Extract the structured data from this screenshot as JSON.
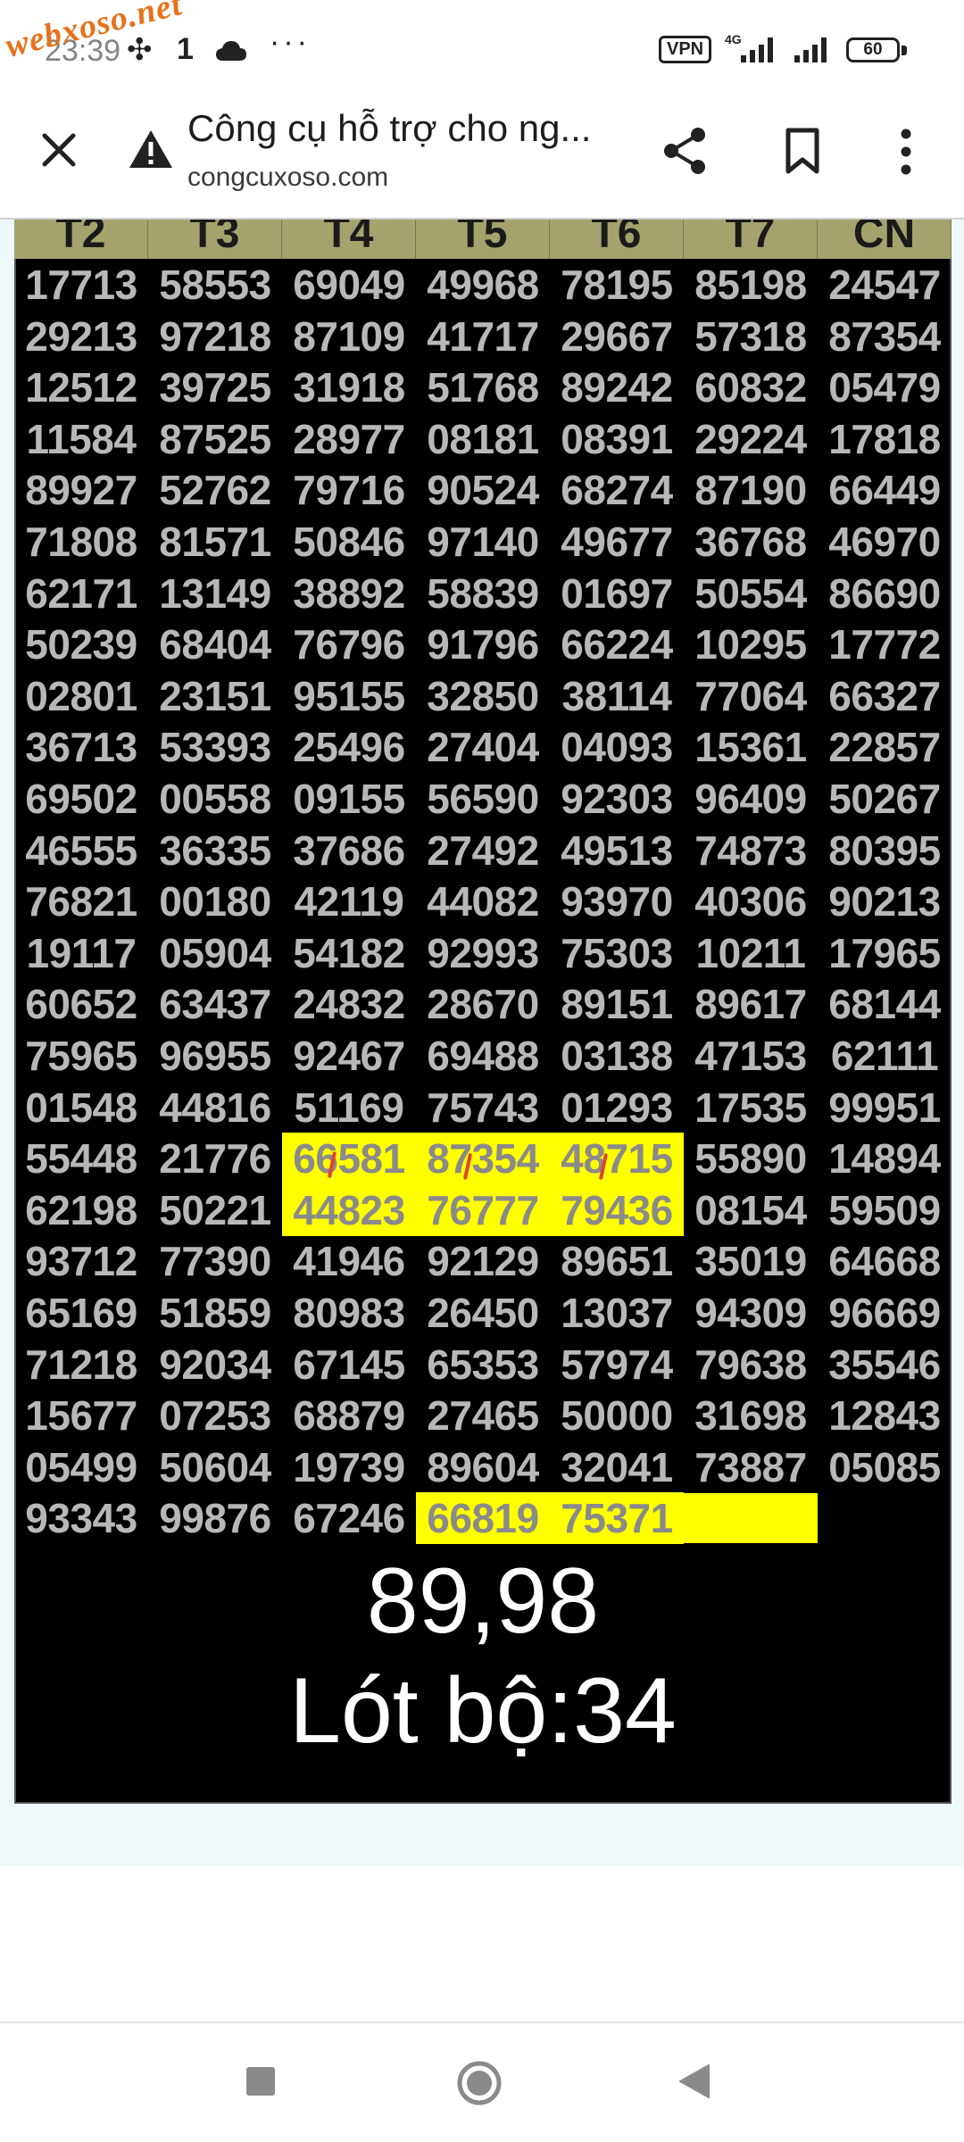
{
  "status_bar": {
    "watermark": "webxoso.net",
    "time": "23:39",
    "notification_count": "1",
    "more_symbol": "···",
    "vpn_label": "VPN",
    "network_type": "4G",
    "battery": "60"
  },
  "toolbar": {
    "page_title": "Công cụ hỗ trợ cho ng...",
    "page_url": "congcuxoso.com"
  },
  "table": {
    "headers": [
      "T2",
      "T3",
      "T4",
      "T5",
      "T6",
      "T7",
      "CN"
    ],
    "rows": [
      [
        "17713",
        "58553",
        "69049",
        "49968",
        "78195",
        "85198",
        "24547"
      ],
      [
        "29213",
        "97218",
        "87109",
        "41717",
        "29667",
        "57318",
        "87354"
      ],
      [
        "12512",
        "39725",
        "31918",
        "51768",
        "89242",
        "60832",
        "05479"
      ],
      [
        "11584",
        "87525",
        "28977",
        "08181",
        "08391",
        "29224",
        "17818"
      ],
      [
        "89927",
        "52762",
        "79716",
        "90524",
        "68274",
        "87190",
        "66449"
      ],
      [
        "71808",
        "81571",
        "50846",
        "97140",
        "49677",
        "36768",
        "46970"
      ],
      [
        "62171",
        "13149",
        "38892",
        "58839",
        "01697",
        "50554",
        "86690"
      ],
      [
        "50239",
        "68404",
        "76796",
        "91796",
        "66224",
        "10295",
        "17772"
      ],
      [
        "02801",
        "23151",
        "95155",
        "32850",
        "38114",
        "77064",
        "66327"
      ],
      [
        "36713",
        "53393",
        "25496",
        "27404",
        "04093",
        "15361",
        "22857"
      ],
      [
        "69502",
        "00558",
        "09155",
        "56590",
        "92303",
        "96409",
        "50267"
      ],
      [
        "46555",
        "36335",
        "37686",
        "27492",
        "49513",
        "74873",
        "80395"
      ],
      [
        "76821",
        "00180",
        "42119",
        "44082",
        "93970",
        "40306",
        "90213"
      ],
      [
        "19117",
        "05904",
        "54182",
        "92993",
        "75303",
        "10211",
        "17965"
      ],
      [
        "60652",
        "63437",
        "24832",
        "28670",
        "89151",
        "89617",
        "68144"
      ],
      [
        "75965",
        "96955",
        "92467",
        "69488",
        "03138",
        "47153",
        "62111"
      ],
      [
        "01548",
        "44816",
        "51169",
        "75743",
        "01293",
        "17535",
        "99951"
      ],
      [
        "55448",
        "21776",
        "66581",
        "87354",
        "48715",
        "55890",
        "14894"
      ],
      [
        "62198",
        "50221",
        "44823",
        "76777",
        "79436",
        "08154",
        "59509"
      ],
      [
        "93712",
        "77390",
        "41946",
        "92129",
        "89651",
        "35019",
        "64668"
      ],
      [
        "65169",
        "51859",
        "80983",
        "26450",
        "13037",
        "94309",
        "96669"
      ],
      [
        "71218",
        "92034",
        "67145",
        "65353",
        "57974",
        "79638",
        "35546"
      ],
      [
        "15677",
        "07253",
        "68879",
        "27465",
        "50000",
        "31698",
        "12843"
      ],
      [
        "05499",
        "50604",
        "19739",
        "89604",
        "32041",
        "73887",
        "05085"
      ],
      [
        "93343",
        "99876",
        "67246",
        "66819",
        "75371",
        "",
        ""
      ]
    ],
    "highlight_color": "#ffff00"
  },
  "result": {
    "numbers": "89,98",
    "lot_bo": "Lót bộ:34"
  },
  "icons": {
    "close": "close-icon",
    "warning": "warning-icon",
    "share": "share-icon",
    "bookmark": "bookmark-icon",
    "menu": "more-vert-icon",
    "nav_recent": "square-icon",
    "nav_home": "circle-icon",
    "nav_back": "triangle-back-icon"
  }
}
